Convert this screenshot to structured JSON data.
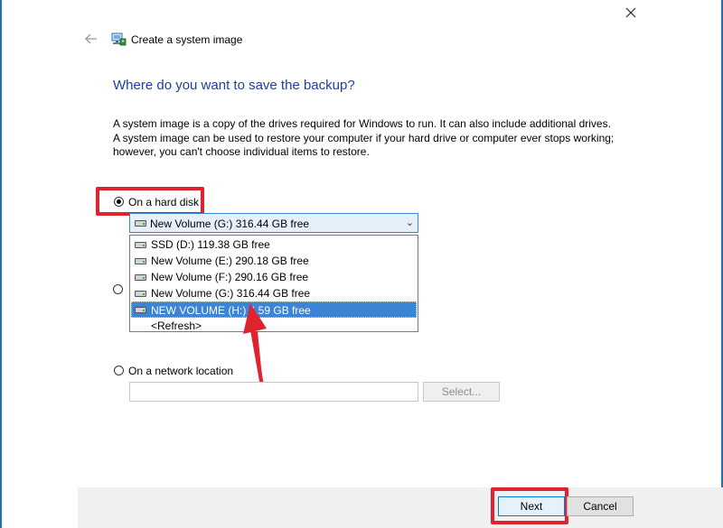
{
  "window": {
    "title": "Create a system image"
  },
  "heading": "Where do you want to save the backup?",
  "description": "A system image is a copy of the drives required for Windows to run. It can also include additional drives. A system image can be used to restore your computer if your hard drive or computer ever stops working; however, you can't choose individual items to restore.",
  "options": {
    "hard_disk": {
      "label": "On a hard disk",
      "checked": true
    },
    "network": {
      "label": "On a network location",
      "checked": false
    }
  },
  "combo": {
    "selected": "New Volume (G:)  316.44 GB free",
    "items": [
      {
        "label": "SSD (D:)  119.38 GB free",
        "selected": false
      },
      {
        "label": "New Volume (E:)  290.18 GB free",
        "selected": false
      },
      {
        "label": "New Volume (F:)  290.16 GB free",
        "selected": false
      },
      {
        "label": "New Volume (G:)  316.44 GB free",
        "selected": false
      },
      {
        "label": "NEW VOLUME (H:)  4.59 GB free",
        "selected": true
      },
      {
        "label": "<Refresh>",
        "selected": false
      }
    ]
  },
  "network": {
    "input_value": "",
    "select_label": "Select..."
  },
  "buttons": {
    "next": "Next",
    "cancel": "Cancel"
  },
  "colors": {
    "accent": "#1f3fa0",
    "highlight": "#e0242f",
    "selection": "#3b84d6"
  },
  "icons": [
    "close-icon",
    "back-arrow-icon",
    "backup-icon",
    "drive-icon",
    "chevron-down-icon",
    "arrow-annotation-icon"
  ]
}
